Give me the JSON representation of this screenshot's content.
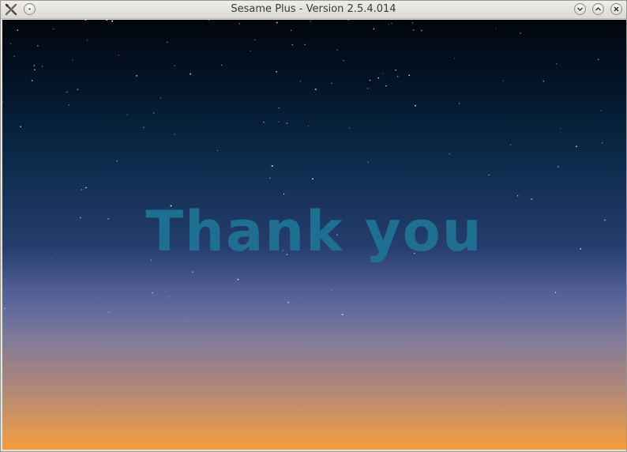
{
  "window": {
    "title": "Sesame Plus - Version 2.5.4.014",
    "icons": {
      "app": "tools-x-icon",
      "menu": "dot-menu-icon",
      "minimize": "chevron-down-icon",
      "maximize": "chevron-up-icon",
      "close": "close-icon"
    }
  },
  "main": {
    "message": "Thank you",
    "colors": {
      "message": "#1f6f93",
      "sky_top": "#02060c",
      "sky_bottom": "#f49b3c"
    }
  }
}
